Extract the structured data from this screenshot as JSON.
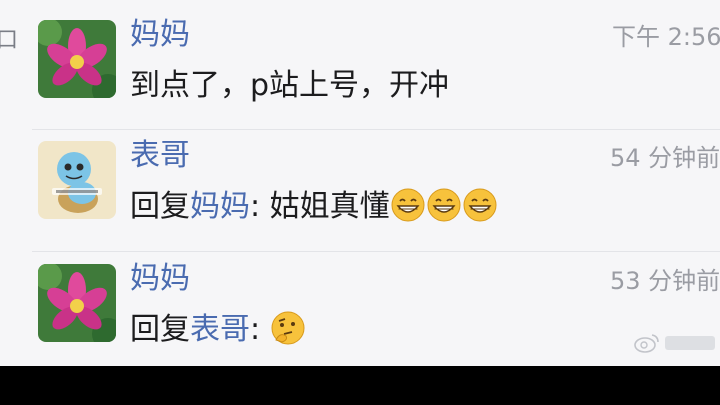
{
  "left_glyph": "口",
  "messages": [
    {
      "avatar": "lotus-flower-avatar",
      "sender": "妈妈",
      "time": "下午 2:56",
      "text": "到点了，p站上号，开冲"
    },
    {
      "avatar": "squirtle-avatar",
      "sender": "表哥",
      "time": "54 分钟前",
      "reply_prefix": "回复",
      "reply_to": "妈妈",
      "separator": ": ",
      "text": "姑姐真懂",
      "emojis": [
        "grin-emoji",
        "grin-emoji",
        "grin-emoji"
      ]
    },
    {
      "avatar": "lotus-flower-avatar",
      "sender": "妈妈",
      "time": "53 分钟前",
      "reply_prefix": "回复",
      "reply_to": "表哥",
      "separator": ": ",
      "emojis": [
        "thinking-emoji"
      ]
    }
  ],
  "colors": {
    "name": "#4a6bb0",
    "text": "#1c1c1e",
    "time": "#9a9ca3",
    "background": "#f6f6f8"
  }
}
